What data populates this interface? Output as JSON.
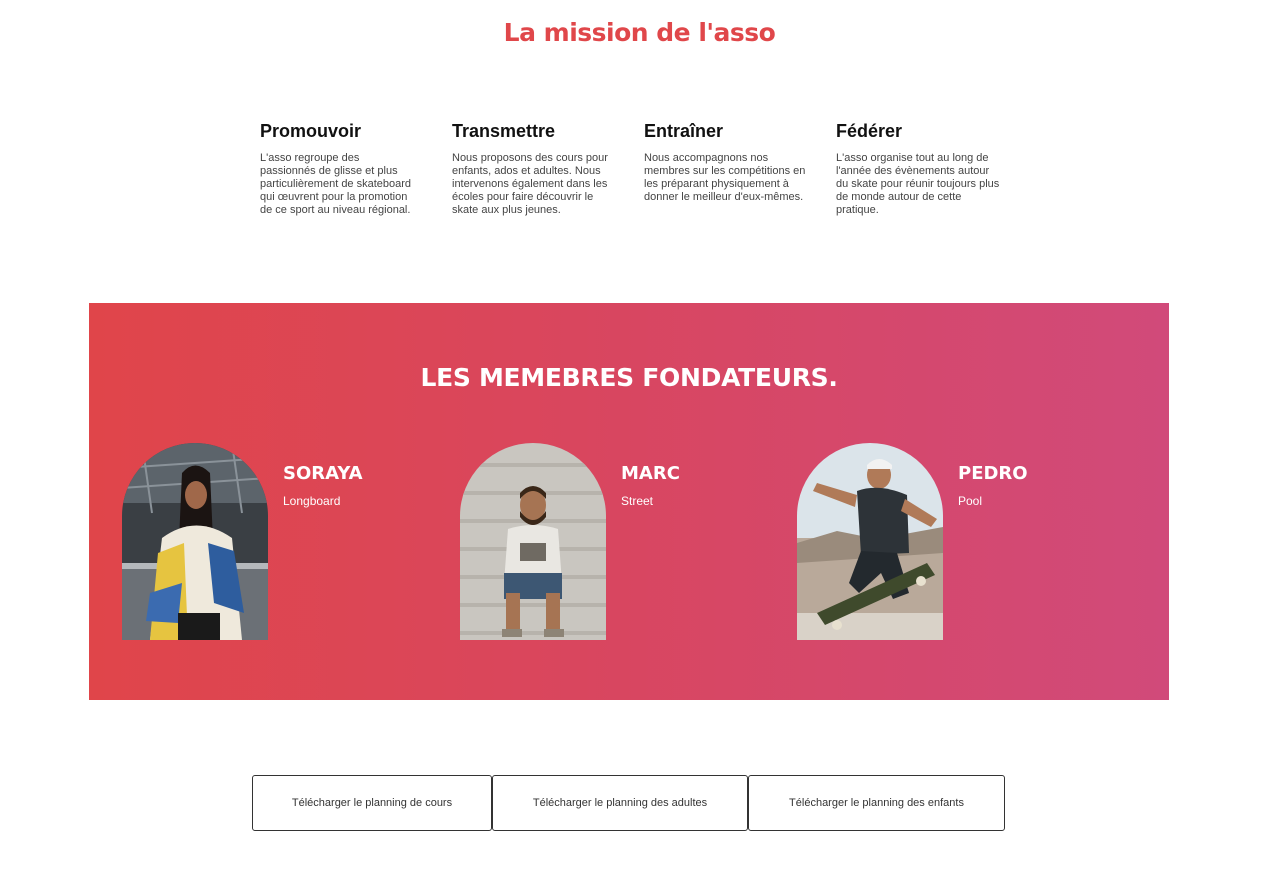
{
  "colors": {
    "accent": "#e0474a",
    "gradient_start": "#e0454a",
    "gradient_end": "#d14a7a",
    "text_dark": "#111111"
  },
  "mission": {
    "title": "La mission de l'asso",
    "pillars": [
      {
        "title": "Promouvoir",
        "text": "L'asso regroupe des passionnés de glisse et plus particulièrement de skateboard qui œuvrent pour la promotion de ce sport au niveau régional."
      },
      {
        "title": "Transmettre",
        "text": "Nous proposons des cours pour enfants, ados et adultes. Nous intervenons également dans les écoles pour faire découvrir le skate aux plus jeunes."
      },
      {
        "title": "Entraîner",
        "text": "Nous accompagnons nos membres sur les compétitions en les préparant physiquement à donner le meilleur d'eux-mêmes."
      },
      {
        "title": "Fédérer",
        "text": "L'asso organise tout au long de l'année des évènements autour du skate pour réunir toujours plus de monde autour de cette pratique."
      }
    ]
  },
  "founders": {
    "title": "LES MEMEBRES FONDATEURS.",
    "members": [
      {
        "name": "SORAYA",
        "style": "Longboard"
      },
      {
        "name": "MARC",
        "style": "Street"
      },
      {
        "name": "PEDRO",
        "style": "Pool"
      }
    ]
  },
  "downloads": {
    "buttons": [
      "Télécharger le planning de cours",
      "Télécharger le planning des adultes",
      "Télécharger le planning des enfants"
    ]
  }
}
